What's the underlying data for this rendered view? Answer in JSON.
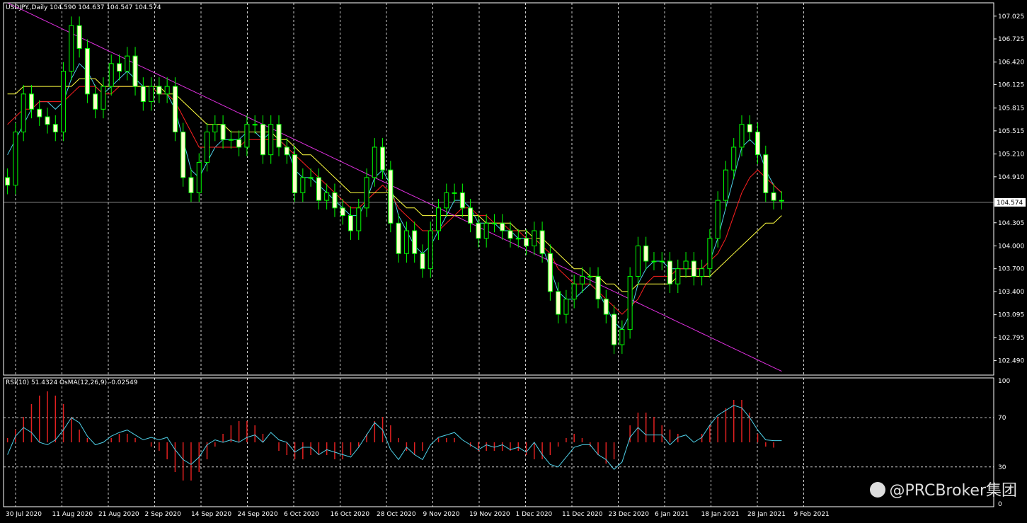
{
  "header": {
    "symbol_line": "USDJPY.,Daily  104.590 104.637 104.547 104.574",
    "indicator_line": "RSI(10) 51.4324  OsMA(12,26,9) -0.02549"
  },
  "watermark": "@PRCBroker集团",
  "colors": {
    "bull": "#00ff00",
    "bear": "#00ff00",
    "ma_fast": "#4fd0e8",
    "ma_mid": "#ff2020",
    "ma_slow": "#ffff40",
    "ma_long": "#e030e0",
    "rsi": "#4fd0e8",
    "osma": "#e02020"
  },
  "chart_data": [
    {
      "type": "candlestick",
      "title": "USDJPY.,Daily",
      "ylim": [
        102.3,
        107.2
      ],
      "y_ticks": [
        "107.025",
        "106.725",
        "106.420",
        "106.125",
        "105.815",
        "105.515",
        "105.210",
        "104.910",
        "104.305",
        "104.000",
        "103.700",
        "103.400",
        "103.095",
        "102.795",
        "102.490"
      ],
      "current_price": "104.574",
      "x_ticks": [
        "30 Jul 2020",
        "11 Aug 2020",
        "21 Aug 2020",
        "2 Sep 2020",
        "14 Sep 2020",
        "24 Sep 2020",
        "6 Oct 2020",
        "16 Oct 2020",
        "28 Oct 2020",
        "9 Nov 2020",
        "19 Nov 2020",
        "1 Dec 2020",
        "11 Dec 2020",
        "23 Dec 2020",
        "6 Jan 2021",
        "18 Jan 2021",
        "28 Jan 2021",
        "9 Feb 2021"
      ],
      "close": [
        104.8,
        105.5,
        106.0,
        105.8,
        105.7,
        105.6,
        105.5,
        106.3,
        106.9,
        106.6,
        106.0,
        105.8,
        106.1,
        106.4,
        106.3,
        106.5,
        106.1,
        105.9,
        106.1,
        106.0,
        106.1,
        105.5,
        104.9,
        104.7,
        105.1,
        105.5,
        105.6,
        105.4,
        105.4,
        105.3,
        105.6,
        105.6,
        105.2,
        105.6,
        105.3,
        105.2,
        104.7,
        104.9,
        104.9,
        104.6,
        104.7,
        104.5,
        104.4,
        104.2,
        104.5,
        104.9,
        105.3,
        105.0,
        104.3,
        103.9,
        104.2,
        103.9,
        103.7,
        104.2,
        104.5,
        104.7,
        104.7,
        104.5,
        104.3,
        104.1,
        104.3,
        104.3,
        104.2,
        104.1,
        104.1,
        104.0,
        104.2,
        103.9,
        103.4,
        103.1,
        103.3,
        103.5,
        103.6,
        103.6,
        103.3,
        103.1,
        102.7,
        102.9,
        103.6,
        104.0,
        103.8,
        103.8,
        103.8,
        103.5,
        103.7,
        103.8,
        103.6,
        103.7,
        104.1,
        104.6,
        105.0,
        105.3,
        105.6,
        105.5,
        105.2,
        104.7,
        104.6,
        104.6
      ],
      "series": [
        {
          "name": "MA fast",
          "values": [
            105.2,
            105.4,
            105.6,
            105.8,
            105.9,
            105.9,
            105.8,
            105.9,
            106.2,
            106.4,
            106.3,
            106.1,
            106.0,
            106.1,
            106.2,
            106.3,
            106.2,
            106.1,
            106.1,
            106.0,
            106.0,
            105.8,
            105.4,
            105.0,
            104.9,
            105.1,
            105.3,
            105.4,
            105.4,
            105.4,
            105.5,
            105.5,
            105.4,
            105.5,
            105.4,
            105.3,
            105.0,
            104.9,
            104.9,
            104.8,
            104.7,
            104.6,
            104.5,
            104.4,
            104.4,
            104.6,
            104.9,
            105.0,
            104.8,
            104.4,
            104.2,
            104.0,
            103.9,
            104.0,
            104.2,
            104.4,
            104.6,
            104.6,
            104.5,
            104.3,
            104.3,
            104.3,
            104.2,
            104.2,
            104.1,
            104.1,
            104.1,
            104.0,
            103.7,
            103.4,
            103.3,
            103.3,
            103.4,
            103.5,
            103.4,
            103.2,
            103.0,
            102.9,
            103.1,
            103.5,
            103.7,
            103.8,
            103.8,
            103.7,
            103.7,
            103.7,
            103.7,
            103.7,
            103.8,
            104.1,
            104.5,
            104.9,
            105.3,
            105.4,
            105.3,
            105.0,
            104.8,
            104.7
          ]
        },
        {
          "name": "MA mid",
          "values": [
            105.6,
            105.7,
            105.8,
            105.8,
            105.9,
            105.9,
            105.9,
            105.9,
            106.0,
            106.1,
            106.1,
            106.1,
            106.0,
            106.0,
            106.1,
            106.1,
            106.1,
            106.1,
            106.1,
            106.0,
            106.0,
            105.9,
            105.7,
            105.5,
            105.3,
            105.3,
            105.3,
            105.3,
            105.3,
            105.3,
            105.4,
            105.4,
            105.4,
            105.4,
            105.4,
            105.3,
            105.2,
            105.1,
            105.0,
            104.9,
            104.8,
            104.7,
            104.6,
            104.5,
            104.5,
            104.6,
            104.7,
            104.8,
            104.7,
            104.5,
            104.4,
            104.3,
            104.2,
            104.2,
            104.2,
            104.3,
            104.4,
            104.5,
            104.5,
            104.4,
            104.4,
            104.3,
            104.3,
            104.2,
            104.2,
            104.1,
            104.1,
            104.0,
            103.9,
            103.7,
            103.6,
            103.5,
            103.5,
            103.5,
            103.4,
            103.3,
            103.2,
            103.1,
            103.2,
            103.3,
            103.5,
            103.6,
            103.6,
            103.6,
            103.7,
            103.7,
            103.7,
            103.7,
            103.8,
            103.9,
            104.1,
            104.4,
            104.7,
            104.9,
            105.0,
            104.9,
            104.8,
            104.7
          ]
        },
        {
          "name": "MA slow",
          "values": [
            106.0,
            106.0,
            106.1,
            106.1,
            106.1,
            106.1,
            106.1,
            106.1,
            106.1,
            106.2,
            106.2,
            106.2,
            106.1,
            106.1,
            106.1,
            106.1,
            106.1,
            106.1,
            106.1,
            106.1,
            106.0,
            106.0,
            105.9,
            105.8,
            105.7,
            105.6,
            105.6,
            105.6,
            105.5,
            105.5,
            105.5,
            105.5,
            105.5,
            105.5,
            105.4,
            105.4,
            105.3,
            105.2,
            105.2,
            105.1,
            105.0,
            104.9,
            104.8,
            104.7,
            104.7,
            104.7,
            104.7,
            104.7,
            104.7,
            104.6,
            104.5,
            104.5,
            104.4,
            104.4,
            104.4,
            104.4,
            104.4,
            104.4,
            104.4,
            104.4,
            104.3,
            104.3,
            104.3,
            104.3,
            104.2,
            104.2,
            104.1,
            104.1,
            104.0,
            103.9,
            103.8,
            103.7,
            103.7,
            103.6,
            103.6,
            103.5,
            103.5,
            103.4,
            103.4,
            103.5,
            103.5,
            103.5,
            103.5,
            103.5,
            103.6,
            103.6,
            103.6,
            103.6,
            103.6,
            103.7,
            103.8,
            103.9,
            104.0,
            104.1,
            104.2,
            104.3,
            104.3,
            104.4
          ]
        },
        {
          "name": "MA long",
          "values": [
            107.2,
            107.15,
            107.1,
            107.05,
            107.0,
            106.95,
            106.9,
            106.85,
            106.8,
            106.75,
            106.7,
            106.65,
            106.6,
            106.55,
            106.5,
            106.45,
            106.4,
            106.35,
            106.3,
            106.25,
            106.2,
            106.15,
            106.1,
            106.05,
            106.0,
            105.95,
            105.9,
            105.85,
            105.8,
            105.75,
            105.7,
            105.65,
            105.6,
            105.55,
            105.5,
            105.45,
            105.4,
            105.35,
            105.3,
            105.25,
            105.2,
            105.15,
            105.1,
            105.05,
            105.0,
            104.95,
            104.9,
            104.85,
            104.8,
            104.75,
            104.7,
            104.65,
            104.6,
            104.55,
            104.5,
            104.45,
            104.4,
            104.35,
            104.3,
            104.25,
            104.2,
            104.15,
            104.1,
            104.05,
            104.0,
            103.95,
            103.9,
            103.85,
            103.8,
            103.75,
            103.7,
            103.65,
            103.6,
            103.55,
            103.5,
            103.45,
            103.4,
            103.35,
            103.3,
            103.25,
            103.2,
            103.15,
            103.1,
            103.05,
            103.0,
            102.95,
            102.9,
            102.85,
            102.8,
            102.75,
            102.7,
            102.65,
            102.6,
            102.55,
            102.5,
            102.45,
            102.4,
            102.35
          ]
        }
      ]
    },
    {
      "type": "line",
      "title": "RSI(10) 51.4324  OsMA(12,26,9) -0.02549",
      "ylim": [
        0,
        100
      ],
      "y_ticks": [
        "100",
        "70",
        "30",
        "0"
      ],
      "series": [
        {
          "name": "RSI(10)",
          "values": [
            40,
            55,
            62,
            58,
            50,
            48,
            52,
            60,
            70,
            66,
            55,
            48,
            50,
            55,
            58,
            60,
            56,
            52,
            54,
            52,
            54,
            44,
            36,
            32,
            38,
            48,
            52,
            50,
            52,
            50,
            54,
            56,
            50,
            58,
            52,
            50,
            42,
            46,
            46,
            40,
            44,
            42,
            40,
            38,
            46,
            56,
            66,
            60,
            44,
            36,
            46,
            40,
            36,
            48,
            54,
            56,
            58,
            52,
            48,
            44,
            48,
            46,
            48,
            44,
            46,
            42,
            50,
            40,
            32,
            30,
            38,
            46,
            48,
            48,
            40,
            36,
            28,
            34,
            54,
            62,
            56,
            56,
            56,
            48,
            54,
            56,
            50,
            54,
            64,
            72,
            76,
            80,
            78,
            70,
            60,
            52,
            51.4,
            51.4
          ]
        },
        {
          "name": "OsMA(12,26,9)",
          "values": [
            0.02,
            0.06,
            0.12,
            0.18,
            0.22,
            0.24,
            0.22,
            0.18,
            0.12,
            0.06,
            0.02,
            0.0,
            0.0,
            0.02,
            0.04,
            0.04,
            0.02,
            0.0,
            -0.02,
            -0.04,
            -0.08,
            -0.14,
            -0.18,
            -0.18,
            -0.14,
            -0.08,
            -0.02,
            0.04,
            0.08,
            0.1,
            0.1,
            0.08,
            0.04,
            0.0,
            -0.04,
            -0.06,
            -0.08,
            -0.08,
            -0.06,
            -0.06,
            -0.06,
            -0.08,
            -0.08,
            -0.06,
            -0.02,
            0.04,
            0.1,
            0.12,
            0.08,
            0.02,
            -0.04,
            -0.06,
            -0.04,
            0.0,
            0.02,
            0.02,
            0.02,
            0.0,
            -0.02,
            -0.04,
            -0.04,
            -0.04,
            -0.04,
            -0.04,
            -0.04,
            -0.06,
            -0.08,
            -0.08,
            -0.06,
            -0.02,
            0.02,
            0.04,
            0.02,
            -0.02,
            -0.06,
            -0.1,
            -0.08,
            0.0,
            0.08,
            0.14,
            0.14,
            0.12,
            0.08,
            0.06,
            0.04,
            0.0,
            0.0,
            0.04,
            0.08,
            0.12,
            0.16,
            0.2,
            0.2,
            0.14,
            0.04,
            -0.02,
            -0.025
          ]
        }
      ]
    }
  ]
}
